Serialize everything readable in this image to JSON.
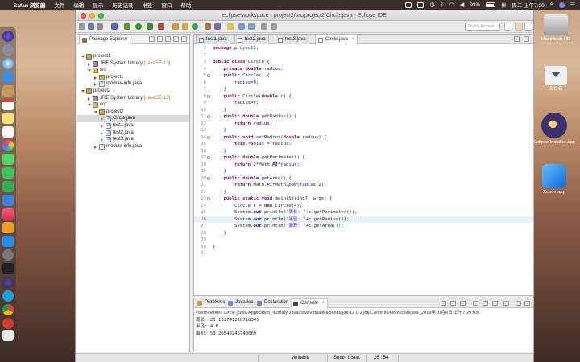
{
  "menubar": {
    "app": "Safari 浏览器",
    "items": [
      "文件",
      "编辑",
      "显示",
      "历史记录",
      "书签",
      "窗口",
      "帮助"
    ],
    "battery": "93%",
    "clock": "周二 上午7:29"
  },
  "window": {
    "title": "eclipse-workspace - project2/src/project2/Circle.java - Eclipse IDE",
    "quick_access": "Quick Access"
  },
  "package_explorer": {
    "title": "Package Explorer",
    "tree": [
      {
        "label": "project1",
        "dec": ""
      },
      {
        "label": "JRE System Library",
        "dec": "[JavaSE-13]"
      },
      {
        "label": "src",
        "dec": ""
      },
      {
        "label": "project1",
        "dec": ""
      },
      {
        "label": "module-info.java",
        "dec": ""
      },
      {
        "label": "project2",
        "dec": ""
      },
      {
        "label": "JRE System Library",
        "dec": "[JavaSE-13]"
      },
      {
        "label": "src",
        "dec": ""
      },
      {
        "label": "project2",
        "dec": ""
      },
      {
        "label": "Circle.java",
        "dec": ""
      },
      {
        "label": "test1.java",
        "dec": ""
      },
      {
        "label": "test2.java",
        "dec": ""
      },
      {
        "label": "test3.java",
        "dec": ""
      },
      {
        "label": "module-info.java",
        "dec": ""
      }
    ]
  },
  "editor": {
    "tabs": [
      "test1.java",
      "test2.java",
      "test3.java",
      "Circle.java"
    ],
    "active_tab": "Circle.java",
    "line_numbers": [
      "1",
      "2",
      "3",
      "4",
      "5",
      "6",
      "7",
      "8",
      "9",
      "10",
      "11",
      "12",
      "13",
      "14",
      "15",
      "16",
      "17",
      "18",
      "19",
      "20",
      "21",
      "22",
      "23",
      "24",
      "25",
      "26",
      "27",
      "28",
      "29",
      "30",
      "31"
    ]
  },
  "console": {
    "tabs": [
      "Problems",
      "Javadoc",
      "Declaration",
      "Console"
    ],
    "terminated": "<terminated> Circle [Java Application] /Library/Java/JavaVirtualMachines/jdk-12.0.2.jdk/Contents/Home/bin/java (2019年10月8日 上午7:29:03)",
    "output": [
      "周长: 25.132741228718345",
      "半径: 4.0",
      "面积: 50.26548245743669"
    ]
  },
  "status": {
    "writable": "Writable",
    "insert": "Smart Insert",
    "position": "26 : 54"
  },
  "desktop": {
    "items": [
      "Macintosh HD",
      "未命名",
      "Eclipse Installer.app",
      "Xcode.app"
    ]
  },
  "colors": {
    "keyword": "#7f0055",
    "field": "#0000c0",
    "string": "#2a00ff",
    "highlight_line": "#e8f2fe"
  }
}
